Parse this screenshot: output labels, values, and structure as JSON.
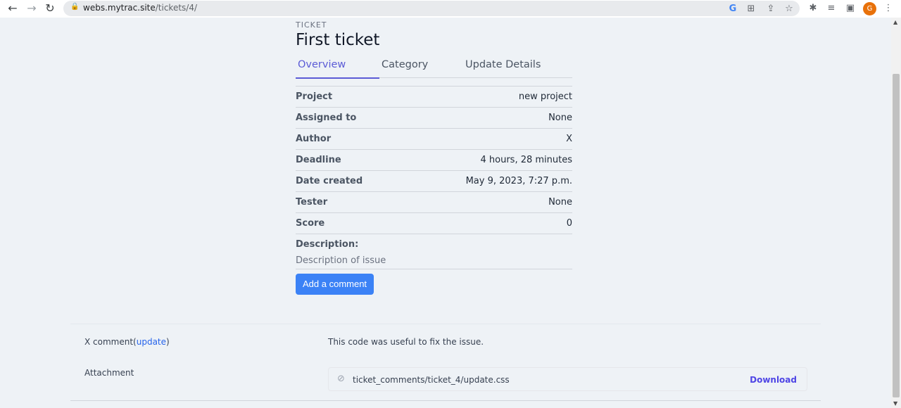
{
  "browser": {
    "url_host": "webs.mytrac.site",
    "url_path": "/tickets/4/",
    "avatar_letter": "G"
  },
  "ticket": {
    "eyebrow": "TICKET",
    "title": "First ticket",
    "tabs": [
      {
        "label": "Overview",
        "active": true
      },
      {
        "label": "Category",
        "active": false
      },
      {
        "label": "Update Details",
        "active": false
      }
    ],
    "fields": [
      {
        "label": "Project",
        "value": "new project"
      },
      {
        "label": "Assigned to",
        "value": "None"
      },
      {
        "label": "Author",
        "value": "X"
      },
      {
        "label": "Deadline",
        "value": "4 hours, 28 minutes"
      },
      {
        "label": "Date created",
        "value": "May 9, 2023, 7:27 p.m."
      },
      {
        "label": "Tester",
        "value": "None"
      },
      {
        "label": "Score",
        "value": "0"
      }
    ],
    "description_label": "Description:",
    "description_value": "Description of issue",
    "add_comment_label": "Add a comment"
  },
  "comment": {
    "author": "X comment(",
    "update_link": "update",
    "author_close": ")",
    "text": "This code was useful to fix the issue.",
    "attachment_label": "Attachment",
    "file_name": "ticket_comments/ticket_4/update.css",
    "download_label": "Download"
  }
}
